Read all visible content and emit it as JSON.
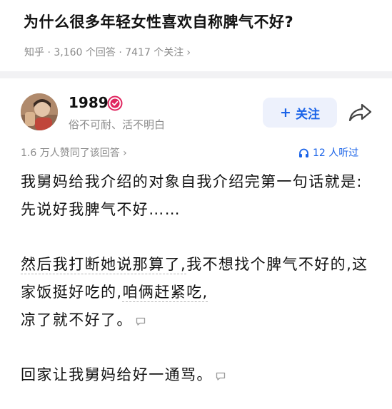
{
  "question": {
    "title": "为什么很多年轻女性喜欢自称脾气不好?",
    "meta": "知乎 · 3,160 个回答 · 7417 个关注"
  },
  "author": {
    "name": "1989",
    "bio": "俗不可耐、活不明白",
    "follow_label": "关注"
  },
  "answer_meta": {
    "votes": "1.6 万人赞同了该回答",
    "listeners": "12 人听过"
  },
  "answer": {
    "p1": "我舅妈给我介绍的对象自我介绍完第一句话就是: 先说好我脾气不好……",
    "p2_a": "然后我打断她说那算了,",
    "p2_b": "我不想找个脾气不好的,",
    "p2_c": "这家饭挺好吃的,",
    "p2_d": "咱俩赶紧吃,",
    "p2_e": "凉了就不好了。",
    "p3": "回家让我舅妈给好一通骂。"
  },
  "colors": {
    "accent": "#1a63e8",
    "follow_bg": "#edf1fc",
    "muted": "#8a8a8a",
    "verify_badge": "#e0245e"
  },
  "icons": [
    "chevron-right-icon",
    "verified-badge-icon",
    "share-icon",
    "headphones-icon",
    "comment-icon"
  ]
}
